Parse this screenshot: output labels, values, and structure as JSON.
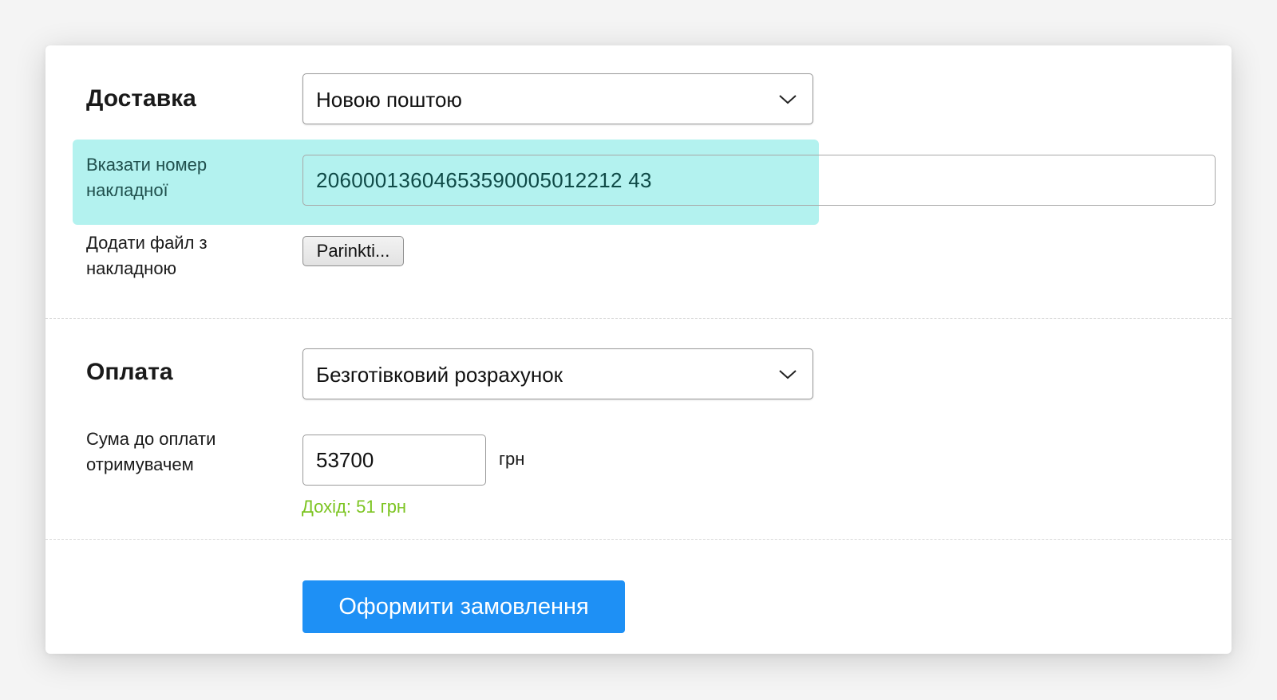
{
  "delivery": {
    "title": "Доставка",
    "method_value": "Новою поштою",
    "invoice_label": "Вказати номер накладної",
    "invoice_value": "20600013604653590005012212 43",
    "file_label": "Додати файл з накладною",
    "file_button_label": "Parinkti..."
  },
  "payment": {
    "title": "Оплата",
    "method_value": "Безготівковий розрахунок",
    "sum_label": "Сума до оплати отримувачем",
    "sum_value": "53700",
    "unit": "грн",
    "income": "Дохід: 51 грн"
  },
  "actions": {
    "submit_label": "Оформити замовлення"
  },
  "colors": {
    "highlight": "#a6f0ec",
    "income": "#7cc421",
    "primary_button": "#1e90f5"
  }
}
